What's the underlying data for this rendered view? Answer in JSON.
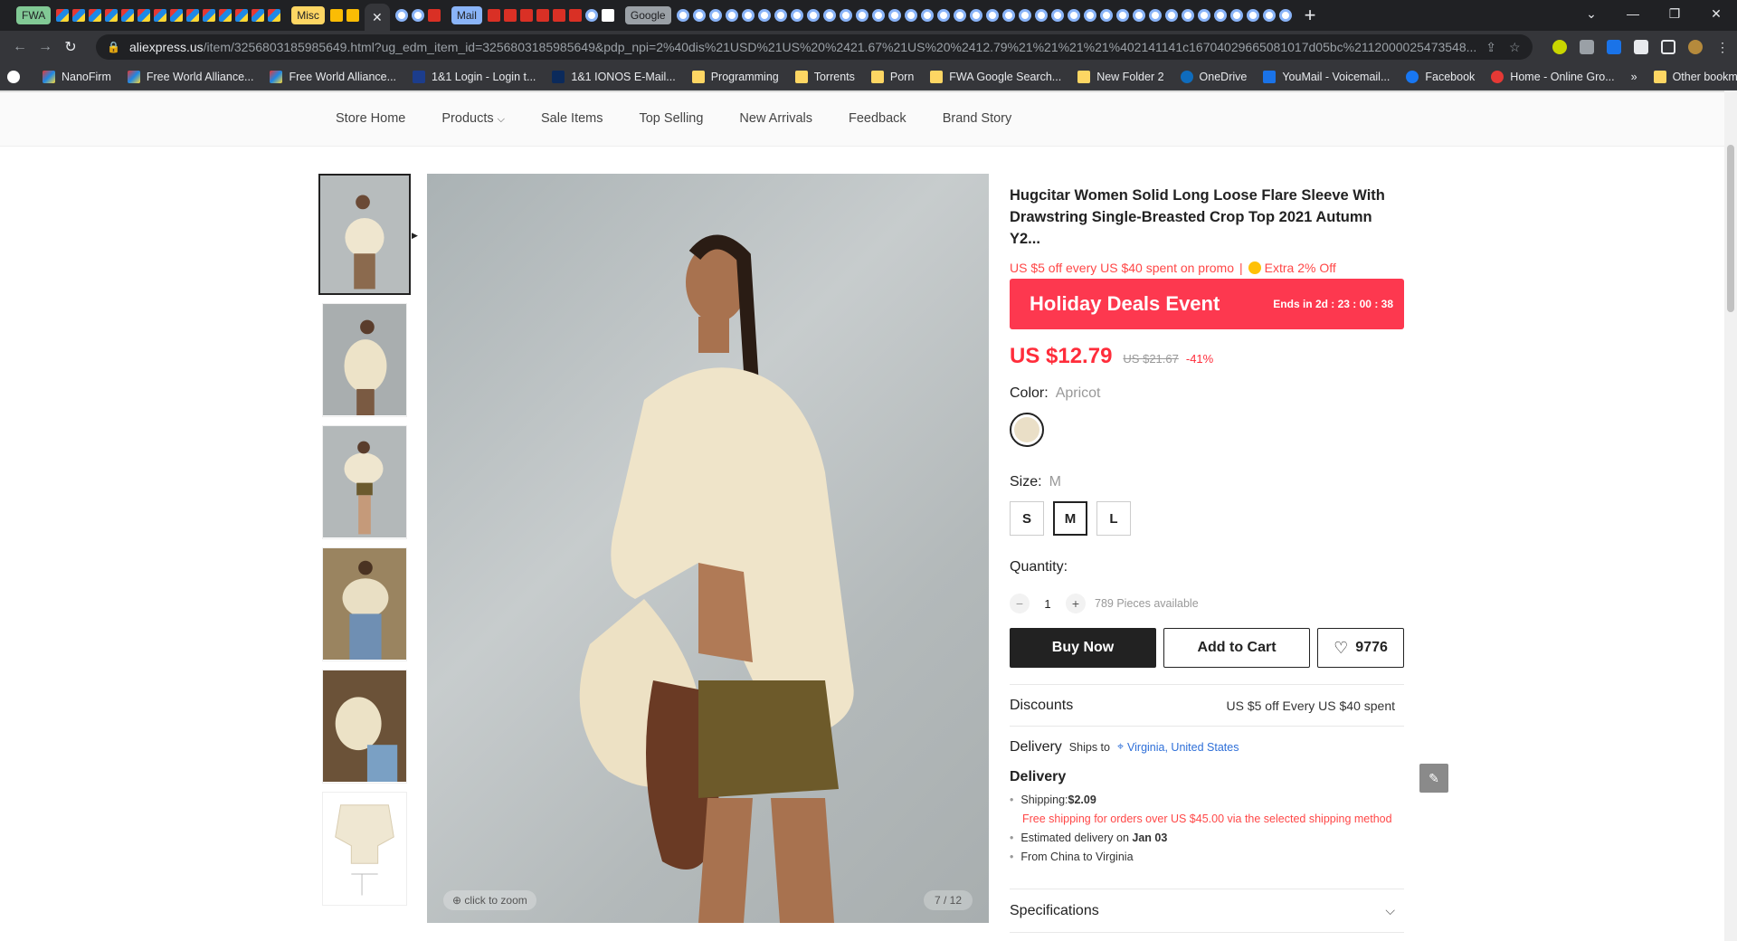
{
  "browser": {
    "tab_groups": [
      "FWA",
      "Misc",
      "Mail",
      "Google"
    ],
    "url_host": "aliexpress.us",
    "url_path": "/item/3256803185985649.html?ug_edm_item_id=3256803185985649&pdp_npi=2%40dis%21USD%21US%20%2421.67%21US%20%2412.79%21%21%21%21%402141141c16704029665081017d05bc%2112000025473548...",
    "bookmarks": [
      "NanoFirm",
      "Free World Alliance...",
      "Free World Alliance...",
      "1&1 Login - Login t...",
      "1&1 IONOS E-Mail...",
      "Programming",
      "Torrents",
      "Porn",
      "FWA Google Search...",
      "New Folder 2",
      "OneDrive",
      "YouMail - Voicemail...",
      "Facebook",
      "Home - Online Gro..."
    ],
    "other_bookmarks": "Other bookmarks",
    "more_bookmarks": "»"
  },
  "store_nav": [
    "Store Home",
    "Products",
    "Sale Items",
    "Top Selling",
    "New Arrivals",
    "Feedback",
    "Brand Story"
  ],
  "gallery": {
    "zoom_hint": "click to zoom",
    "counter": "7 / 12"
  },
  "product": {
    "title": "Hugcitar Women Solid Long Loose Flare Sleeve With Drawstring Single-Breasted Crop Top 2021 Autumn Y2...",
    "promo": "US $5 off every US $40 spent on promo",
    "promo_sep": "|",
    "extra": "Extra 2% Off",
    "banner_title": "Holiday Deals Event",
    "banner_ends": "Ends in 2d : 23 : 00 : 38",
    "price": "US $12.79",
    "original_price": "US $21.67",
    "discount": "-41%",
    "color_label": "Color:",
    "color_value": "Apricot",
    "size_label": "Size:",
    "size_value": "M",
    "sizes": [
      "S",
      "M",
      "L"
    ],
    "quantity_label": "Quantity:",
    "quantity": "1",
    "available": "789 Pieces available",
    "buy_now": "Buy Now",
    "add_to_cart": "Add to Cart",
    "wishlist_count": "9776",
    "discounts_label": "Discounts",
    "discounts_value": "US $5 off Every US $40 spent",
    "delivery_label": "Delivery",
    "ships_to": "Ships to",
    "ships_location": "Virginia, United States",
    "delivery_heading": "Delivery",
    "shipping_label": "Shipping:",
    "shipping_cost": "$2.09",
    "free_shipping": "Free shipping for orders over US $45.00 via the selected shipping method",
    "estimated_label": "Estimated delivery on",
    "estimated_date": "Jan 03",
    "from_to": "From China to Virginia",
    "specifications": "Specifications"
  }
}
